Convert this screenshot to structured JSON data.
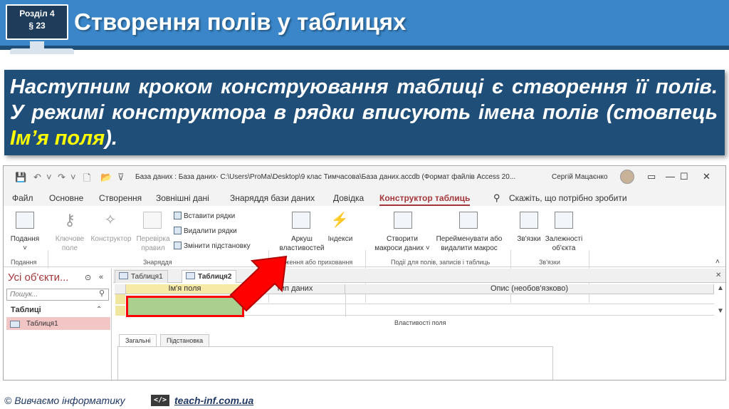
{
  "header": {
    "section_line1": "Розділ 4",
    "section_line2": "§ 23",
    "title": "Створення полів у таблицях"
  },
  "intro": {
    "text_before": "Наступним кроком конструювання таблиці є створення її полів. У режимі конструктора в рядки вписують імена полів (стовпець ",
    "highlight": "Ім’я поля",
    "text_after": ")."
  },
  "window": {
    "title": "База даних : База даних- C:\\Users\\ProMa\\Desktop\\9 клас Тимчасова\\База даних.accdb (Формат файлів Access 20...",
    "user": "Сергій Мацаєнко",
    "tabs": [
      "Файл",
      "Основне",
      "Створення",
      "Зовнішні дані",
      "Знаряддя бази даних",
      "Довідка",
      "Конструктор таблиць",
      "Скажіть, що потрібно зробити"
    ],
    "ribbon": {
      "view_line1": "Подання",
      "key_line1": "Ключове",
      "key_line2": "поле",
      "builder": "Конструктор",
      "test_line1": "Перевірка",
      "test_line2": "правил",
      "insert_rows": "Вставити рядки",
      "delete_rows": "Видалити рядки",
      "modify_lookups": "Змінити підстановку",
      "sheet_line1": "Аркуш",
      "sheet_line2": "властивостей",
      "indexes": "Індекси",
      "create_line1": "Створити",
      "create_line2": "макроси даних ˅",
      "rename_line1": "Перейменувати або",
      "rename_line2": "видалити макрос",
      "relations": "Зв'язки",
      "dep_line1": "Залежності",
      "dep_line2": "об'єкта",
      "grp_views": "Подання",
      "grp_tools": "Знаряддя",
      "grp_show": "Відображення або приховання",
      "grp_events": "Події для полів, записів і таблиць",
      "grp_rel": "Зв'язки"
    },
    "nav": {
      "title": "Усі об'єкти...",
      "search_placeholder": "Пошук...",
      "group": "Таблиці",
      "item": "Таблиця1"
    },
    "doc_tabs": [
      "Таблиця1",
      "Таблиця2"
    ],
    "grid": {
      "col_name": "Ім'я поля",
      "col_type": "Тип даних",
      "col_desc": "Опис (необов'язково)"
    },
    "props": {
      "label": "Властивості поля",
      "tab_general": "Загальні",
      "tab_lookup": "Підстановка"
    }
  },
  "footer": {
    "copyright": "© Вивчаємо інформатику",
    "code_badge": "</>",
    "link": "teach-inf.com.ua"
  },
  "colors": {
    "header_blue": "#3a86c8",
    "dark_blue": "#1f4e79",
    "highlight_yellow": "#ffff00",
    "access_accent": "#a4373a",
    "arrow_red": "#ff0000",
    "field_green": "#a9d08e"
  }
}
